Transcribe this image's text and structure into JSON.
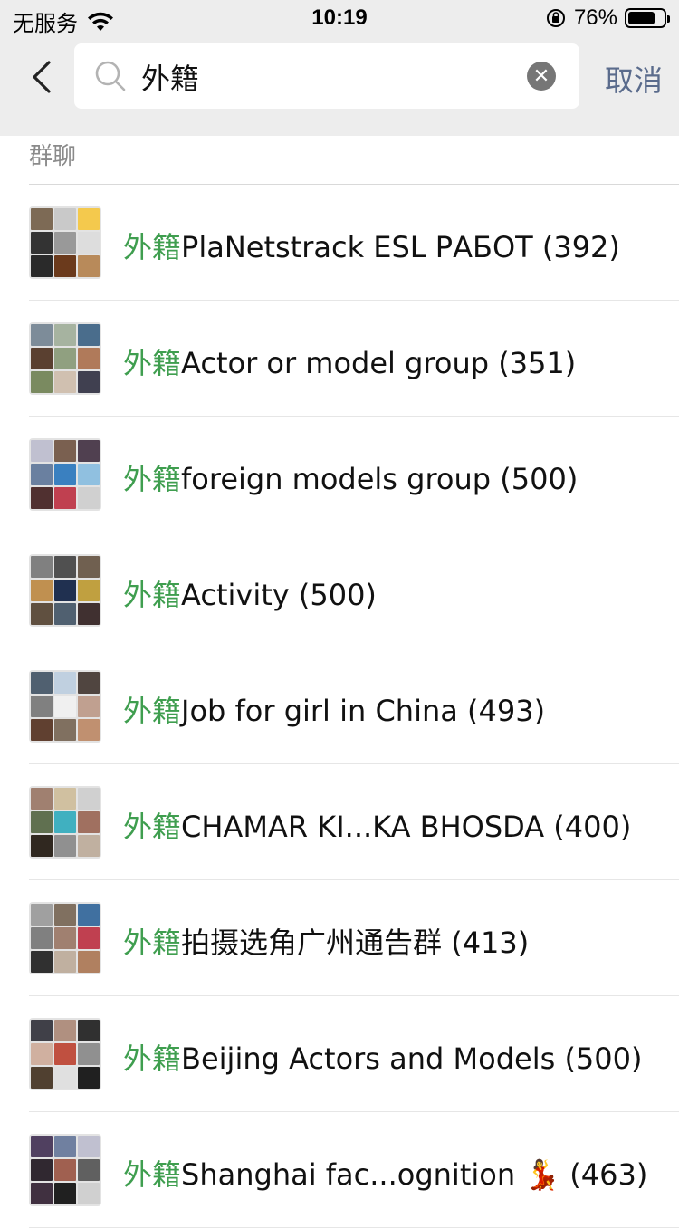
{
  "status_bar": {
    "carrier": "无服务",
    "time": "10:19",
    "battery_percent": "76%",
    "battery_level": 0.76
  },
  "search": {
    "query": "外籍",
    "cancel_label": "取消"
  },
  "section": {
    "title": "群聊"
  },
  "results": [
    {
      "keyword": "外籍",
      "name": "PlaNetstrack ESL РАБОТ",
      "count": "(392)",
      "colors": [
        "#7d6a55",
        "#c9c9c9",
        "#f4c94d",
        "#333",
        "#999",
        "#ddd",
        "#2a2a2a",
        "#6b3a1c",
        "#b88a5a"
      ]
    },
    {
      "keyword": "外籍",
      "name": "Actor or model group",
      "count": "(351)",
      "colors": [
        "#7d8c99",
        "#a6b3a0",
        "#4a6d8c",
        "#5a4030",
        "#90a080",
        "#b07a5a",
        "#7a8a60",
        "#d0c0b0",
        "#404050"
      ]
    },
    {
      "keyword": "外籍",
      "name": "foreign models group",
      "count": "(500)",
      "colors": [
        "#c0c0d0",
        "#7a6050",
        "#504050",
        "#6a80a0",
        "#3a80c0",
        "#90c0e0",
        "#503030",
        "#c04050",
        "#d0d0d0"
      ]
    },
    {
      "keyword": "外籍",
      "name": "Activity",
      "count": "(500)",
      "colors": [
        "#808080",
        "#505050",
        "#706050",
        "#c09050",
        "#203050",
        "#c0a040",
        "#605040",
        "#506070",
        "#403030"
      ]
    },
    {
      "keyword": "外籍",
      "name": "Job for girl in China",
      "count": "(493)",
      "colors": [
        "#506070",
        "#c0d0e0",
        "#504540",
        "#808080",
        "#f0f0f0",
        "#c0a090",
        "#604030",
        "#807060",
        "#c09070"
      ]
    },
    {
      "keyword": "外籍",
      "name": "CHAMAR KI...KA BHOSDA",
      "count": "(400)",
      "colors": [
        "#a08070",
        "#d0c0a0",
        "#d0d0d0",
        "#607050",
        "#40b0c0",
        "#a07060",
        "#302820",
        "#909090",
        "#c0b0a0"
      ]
    },
    {
      "keyword": "外籍",
      "name": "拍摄选角广州通告群",
      "count": "(413)",
      "colors": [
        "#a0a0a0",
        "#807060",
        "#4070a0",
        "#808080",
        "#a08070",
        "#c04050",
        "#303030",
        "#c0b0a0",
        "#b08060"
      ]
    },
    {
      "keyword": "外籍",
      "name": "Beijing Actors and Models",
      "count": "(500)",
      "colors": [
        "#404048",
        "#b09080",
        "#303030",
        "#d0b0a0",
        "#c05040",
        "#909090",
        "#504030",
        "#e0e0e0",
        "#202020"
      ]
    },
    {
      "keyword": "外籍",
      "name": "Shanghai fac...ognition 💃",
      "count": "(463)",
      "colors": [
        "#504060",
        "#7080a0",
        "#c0c0d0",
        "#302830",
        "#a06050",
        "#606060",
        "#403040",
        "#202020",
        "#d0d0d0"
      ]
    }
  ]
}
